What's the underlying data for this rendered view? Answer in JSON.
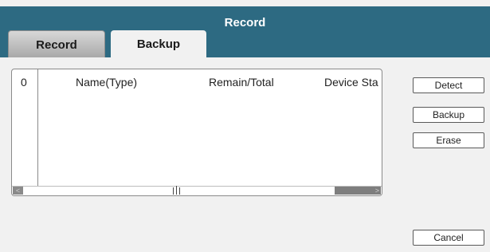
{
  "window": {
    "title": "Record"
  },
  "tabs": [
    {
      "label": "Record",
      "active": false
    },
    {
      "label": "Backup",
      "active": true
    }
  ],
  "device_table": {
    "columns": [
      "0",
      "Name(Type)",
      "Remain/Total",
      "Device Sta"
    ],
    "rows": []
  },
  "actions": {
    "detect": "Detect",
    "backup": "Backup",
    "erase": "Erase",
    "cancel": "Cancel"
  },
  "colors": {
    "titlebar": "#2d6a82",
    "background": "#f1f1f1",
    "title_text": "#ffffff"
  }
}
